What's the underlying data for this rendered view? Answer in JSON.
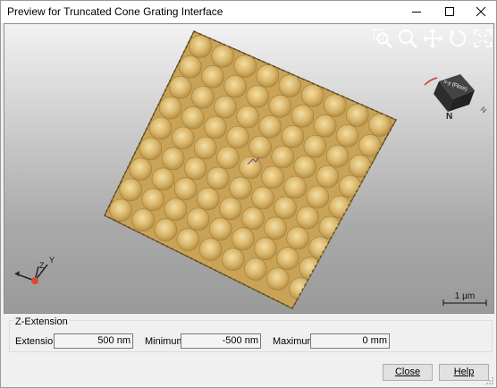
{
  "window": {
    "title": "Preview for Truncated Cone Grating Interface",
    "minimize_glyph": "—",
    "maximize_glyph": "☐",
    "close_glyph": "✕"
  },
  "viewport": {
    "tools": [
      "zoom-window-icon",
      "zoom-icon",
      "pan-icon",
      "rotate-icon",
      "fit-view-icon"
    ],
    "orientation_cube": {
      "face_label": "x-y (Floor)",
      "north_label": "N",
      "axis_label": "N"
    },
    "triad": {
      "y_label": "Y",
      "z_label": "Z"
    },
    "scale_bar_label": "1 µm"
  },
  "z_extension": {
    "group_label": "Z-Extension",
    "extension_label": "Extension",
    "extension_value": "500 nm",
    "minimum_label": "Minimum",
    "minimum_value": "-500 nm",
    "maximum_label": "Maximum",
    "maximum_value": "0 mm"
  },
  "buttons": {
    "close_label": "Close",
    "help_label": "Help"
  }
}
